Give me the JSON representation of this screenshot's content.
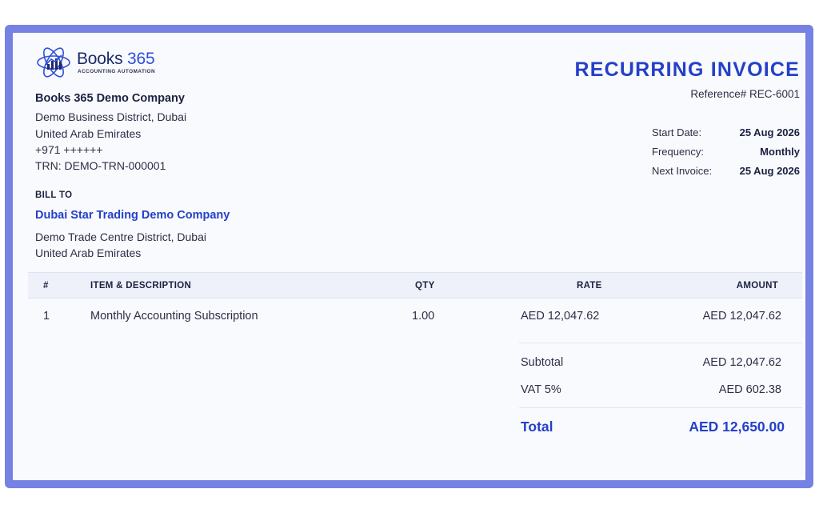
{
  "brand": {
    "name_part1": "Books ",
    "name_part2": "365",
    "tagline": "ACCOUNTING AUTOMATION",
    "primary_color": "#2440c9",
    "frame_color": "#7582e3"
  },
  "company": {
    "name": "Books 365 Demo Company",
    "address_lines": [
      "Demo Business District, Dubai",
      "United Arab Emirates",
      "+971 ++++++",
      "TRN: DEMO-TRN-000001"
    ]
  },
  "document": {
    "title": "RECURRING INVOICE",
    "reference": "Reference# REC-6001",
    "meta": [
      {
        "label": "Start Date:",
        "value": "25 Aug 2026"
      },
      {
        "label": "Frequency:",
        "value": "Monthly"
      },
      {
        "label": "Next Invoice:",
        "value": "25 Aug 2026"
      }
    ]
  },
  "bill_to": {
    "label": "BILL TO",
    "name": "Dubai Star Trading Demo Company",
    "address_lines": [
      "Demo Trade Centre District, Dubai",
      "United Arab Emirates"
    ]
  },
  "table": {
    "headers": {
      "num": "#",
      "item": "ITEM & DESCRIPTION",
      "qty": "QTY",
      "rate": "RATE",
      "amount": "AMOUNT"
    },
    "rows": [
      {
        "num": "1",
        "item": "Monthly Accounting Subscription",
        "qty": "1.00",
        "rate": "AED 12,047.62",
        "amount": "AED 12,047.62"
      }
    ]
  },
  "summary": {
    "subtotal_label": "Subtotal",
    "subtotal_value": "AED 12,047.62",
    "vat_label": "VAT 5%",
    "vat_value": "AED 602.38",
    "total_label": "Total",
    "total_value": "AED 12,650.00"
  }
}
